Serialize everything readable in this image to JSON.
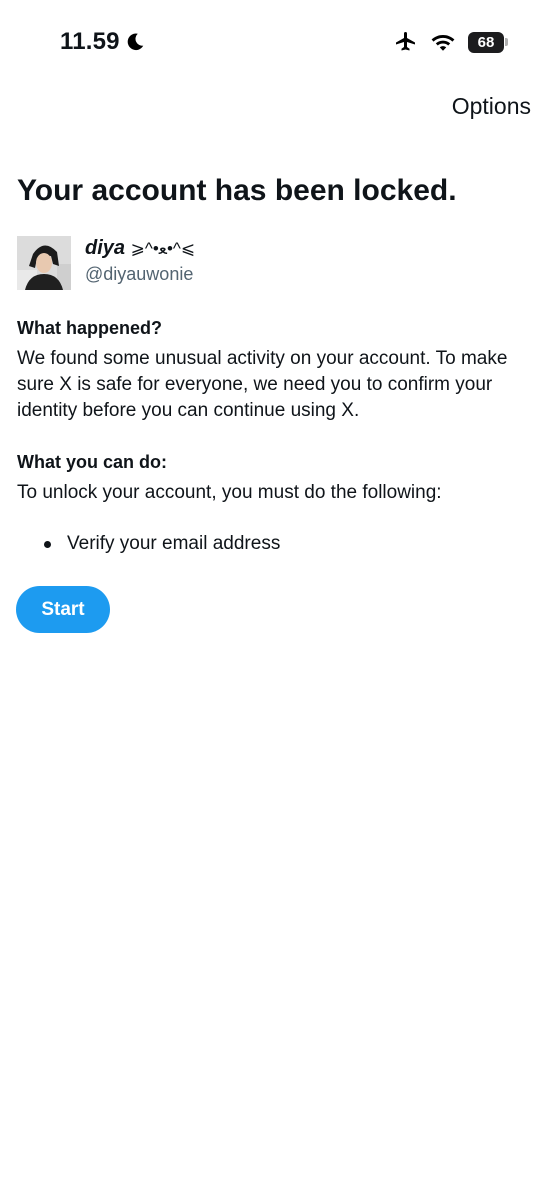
{
  "status_bar": {
    "time": "11.59",
    "battery_level": "68",
    "icons": [
      "moon-icon",
      "airplane-icon",
      "wifi-icon",
      "battery-icon"
    ]
  },
  "header": {
    "options_label": "Options"
  },
  "main": {
    "title": "Your account has been locked.",
    "profile": {
      "display_name": "diya",
      "display_name_decoration": "⩾^•ﻌ•^⩽",
      "handle": "@diyauwonie"
    },
    "what_happened": {
      "heading": "What happened?",
      "body": "We found some unusual activity on your account. To make sure X is safe for everyone, we need you to confirm your identity before you can continue using X."
    },
    "what_you_can_do": {
      "heading": "What you can do:",
      "body": "To unlock your account, you must do the following:",
      "steps": [
        "Verify your email address"
      ]
    },
    "start_label": "Start"
  },
  "colors": {
    "accent": "#1d9bf0",
    "text_primary": "#0f1419",
    "text_secondary": "#536471"
  }
}
